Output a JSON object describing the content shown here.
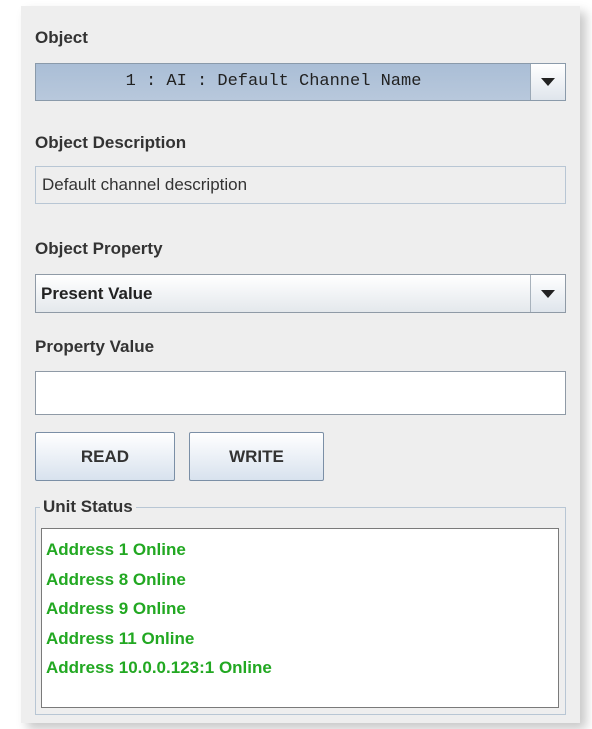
{
  "object": {
    "label": "Object",
    "selected": "1 : AI : Default Channel Name",
    "dropdown_icon": "chevron-down-icon"
  },
  "object_description": {
    "label": "Object Description",
    "value": "Default channel description"
  },
  "object_property": {
    "label": "Object Property",
    "selected": "Present Value",
    "dropdown_icon": "chevron-down-icon"
  },
  "property_value": {
    "label": "Property Value",
    "value": ""
  },
  "buttons": {
    "read": "READ",
    "write": "WRITE"
  },
  "unit_status": {
    "label": "Unit Status",
    "color": "#22a822",
    "lines": [
      "Address 1 Online",
      "Address 8 Online",
      "Address 9 Online",
      "Address 11 Online",
      "Address 10.0.0.123:1 Online"
    ]
  }
}
